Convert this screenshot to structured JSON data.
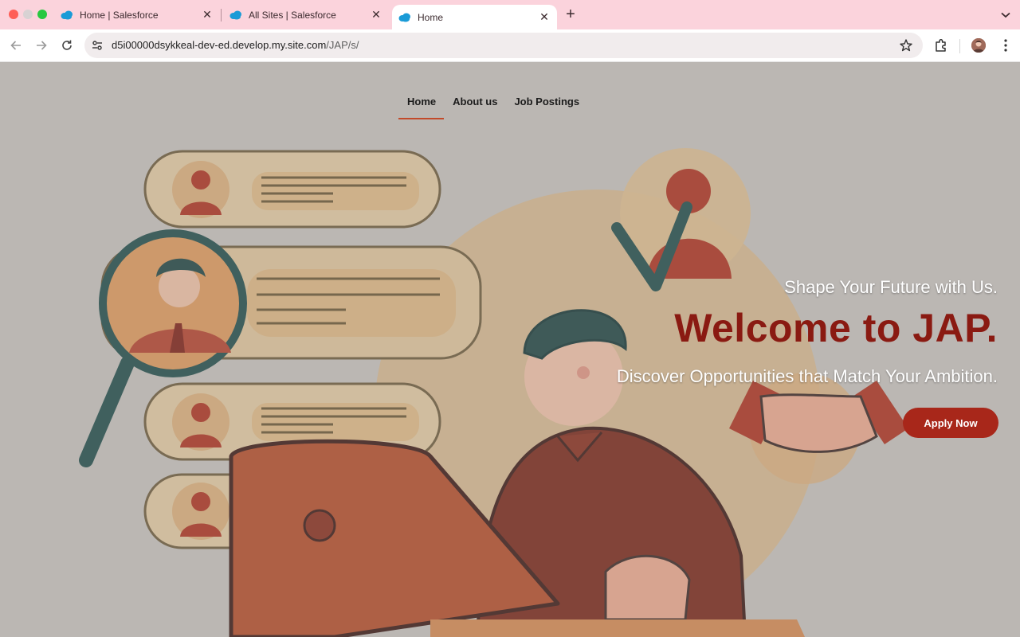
{
  "browser": {
    "tabs": [
      {
        "title": "Home | Salesforce",
        "active": false
      },
      {
        "title": "All Sites | Salesforce",
        "active": false
      },
      {
        "title": "Home",
        "active": true
      }
    ],
    "url_main": "d5i00000dsykkeal-dev-ed.develop.my.site.com",
    "url_path": "/JAP/s/"
  },
  "site": {
    "nav": [
      {
        "label": "Home",
        "active": true
      },
      {
        "label": "About us",
        "active": false
      },
      {
        "label": "Job Postings",
        "active": false
      }
    ],
    "hero": {
      "tagline": "Shape Your Future with Us.",
      "heading": "Welcome to JAP.",
      "subheading": "Discover Opportunities that Match Your Ambition.",
      "cta_label": "Apply Now"
    }
  },
  "colors": {
    "tabstrip": "#fbd3dc",
    "heading": "#8a1a12",
    "cta": "#a8271a",
    "nav_underline": "#c24a2a"
  },
  "icons": [
    "salesforce-cloud-icon",
    "close-icon",
    "plus-icon",
    "chevron-down-icon",
    "back-arrow-icon",
    "forward-arrow-icon",
    "reload-icon",
    "site-settings-icon",
    "bookmark-star-icon",
    "extensions-icon",
    "profile-avatar-icon",
    "more-vert-icon"
  ]
}
